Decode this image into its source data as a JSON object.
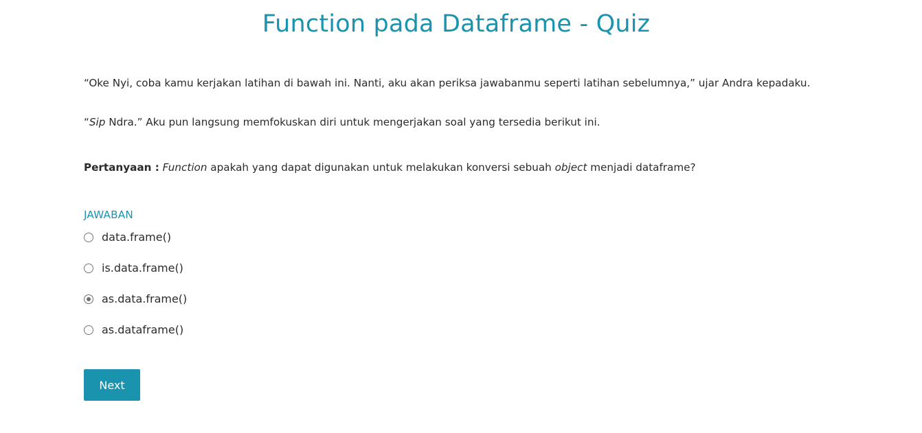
{
  "page_title": "Function pada Dataframe - Quiz",
  "paragraph1": "“Oke Nyi, coba kamu kerjakan latihan di bawah ini. Nanti, aku akan periksa jawabanmu seperti latihan sebelumnya,” ujar Andra kepadaku.",
  "paragraph2": {
    "open_quote": "“",
    "italic_word": "Sip",
    "rest": " Ndra.” Aku pun langsung memfokuskan diri untuk mengerjakan soal yang tersedia berikut ini."
  },
  "question": {
    "label": "Pertanyaan :",
    "italic1": "Function",
    "text1": " apakah yang dapat digunakan untuk melakukan konversi sebuah ",
    "italic2": "object",
    "text2": " menjadi dataframe?"
  },
  "answer_heading": "JAWABAN",
  "options": [
    {
      "label": "data.frame()",
      "selected": false
    },
    {
      "label": "is.data.frame()",
      "selected": false
    },
    {
      "label": "as.data.frame()",
      "selected": true
    },
    {
      "label": "as.dataframe()",
      "selected": false
    }
  ],
  "next_button_label": "Next",
  "colors": {
    "accent": "#1a93ae",
    "text": "#2b2b2b",
    "radio_border": "#767676"
  }
}
